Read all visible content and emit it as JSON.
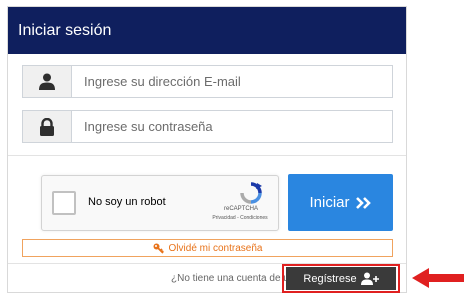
{
  "header": {
    "title": "Iniciar sesión"
  },
  "form": {
    "email_placeholder": "Ingrese su dirección E-mail",
    "email_value": "",
    "password_placeholder": "Ingrese su contraseña",
    "password_value": ""
  },
  "captcha": {
    "label": "No soy un robot",
    "brand": "reCAPTCHA",
    "terms": "Privacidad - Condiciones",
    "checked": false
  },
  "buttons": {
    "login_label": "Iniciar",
    "forgot_label": "Olvidé mi contraseña",
    "register_label": "Regístrese"
  },
  "footer": {
    "register_prompt": "¿No tiene una cuenta de usuario?"
  },
  "colors": {
    "header_bg": "#0f1f5e",
    "login_button": "#2a86e0",
    "forgot_accent": "#e8731a",
    "register_button": "#3a3a3a",
    "highlight": "#e02020"
  },
  "icons": {
    "email": "user-icon",
    "password": "lock-icon",
    "login": "double-chevron-right-icon",
    "forgot": "key-icon",
    "register": "user-plus-icon",
    "annotation": "red-arrow-icon"
  }
}
